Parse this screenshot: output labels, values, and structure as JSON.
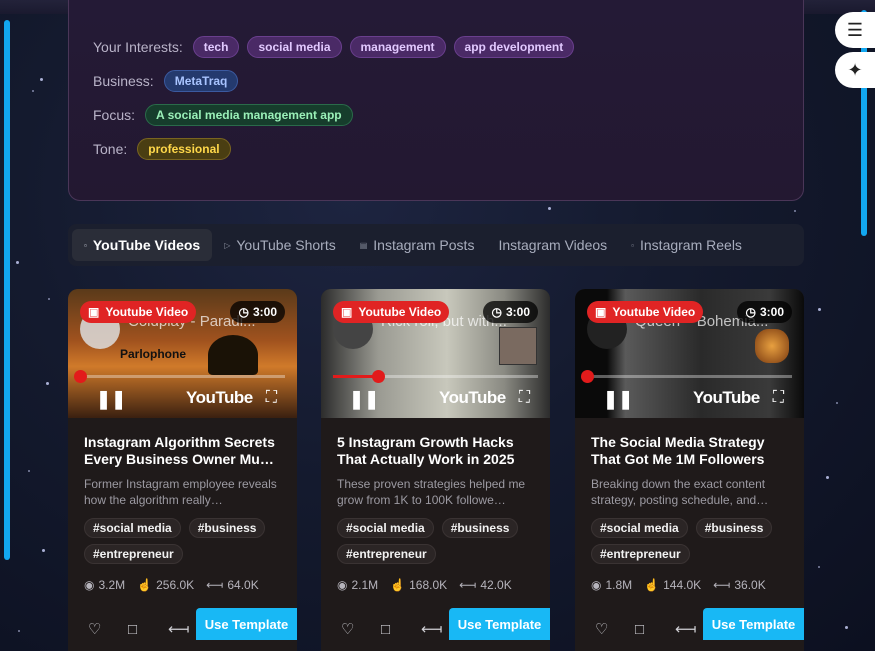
{
  "profile": {
    "rows": [
      {
        "label": "Your Interests:",
        "chips": [
          "tech",
          "social media",
          "management",
          "app development"
        ],
        "color": "purple"
      },
      {
        "label": "Business:",
        "chips": [
          "MetaTraq"
        ],
        "color": "blue"
      },
      {
        "label": "Focus:",
        "chips": [
          "A social media management app"
        ],
        "color": "green"
      },
      {
        "label": "Tone:",
        "chips": [
          "professional"
        ],
        "color": "yellow"
      }
    ]
  },
  "side_buttons": {
    "quote_icon": "quote-icon",
    "sparkle_icon": "sparkle-icon"
  },
  "tabs": [
    {
      "label": "YouTube Videos",
      "active": true
    },
    {
      "label": "YouTube Shorts",
      "active": false
    },
    {
      "label": "Instagram Posts",
      "active": false
    },
    {
      "label": "Instagram Videos",
      "active": false
    },
    {
      "label": "Instagram Reels",
      "active": false
    }
  ],
  "cards": [
    {
      "type_badge": "Youtube Video",
      "duration": "3:00",
      "video_overlay_title": "Coldplay - Paradi...",
      "thumb_caption": "Parlophone",
      "progress": 0.0,
      "title": "Instagram Algorithm Secrets Every Business Owner Mu…",
      "description": "Former Instagram employee reveals how the algorithm really…",
      "tags": [
        "#social media",
        "#business",
        "#entrepreneur"
      ],
      "views": "3.2M",
      "likes": "256.0K",
      "shares": "64.0K",
      "cta": "Use Template"
    },
    {
      "type_badge": "Youtube Video",
      "duration": "3:00",
      "video_overlay_title": "Rick roll, but with...",
      "thumb_caption": "",
      "progress": 0.22,
      "title": "5 Instagram Growth Hacks That Actually Work in 2025",
      "description": "These proven strategies helped me grow from 1K to 100K followe…",
      "tags": [
        "#social media",
        "#business",
        "#entrepreneur"
      ],
      "views": "2.1M",
      "likes": "168.0K",
      "shares": "42.0K",
      "cta": "Use Template"
    },
    {
      "type_badge": "Youtube Video",
      "duration": "3:00",
      "video_overlay_title": "Queen – Bohemia...",
      "thumb_caption": "",
      "progress": 0.0,
      "title": "The Social Media Strategy That Got Me 1M Followers",
      "description": "Breaking down the exact content strategy, posting schedule, and…",
      "tags": [
        "#social media",
        "#business",
        "#entrepreneur"
      ],
      "views": "1.8M",
      "likes": "144.0K",
      "shares": "36.0K",
      "cta": "Use Template"
    }
  ],
  "player": {
    "brand": "YouTube"
  },
  "colors": {
    "accent": "#18b8f5",
    "badge_red": "#e02424",
    "rail": "#12a7f0"
  }
}
